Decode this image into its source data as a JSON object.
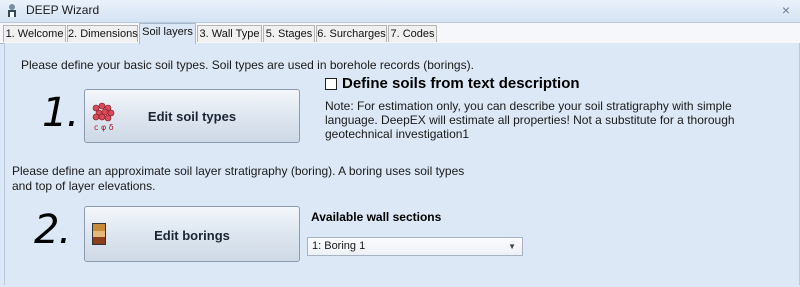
{
  "window": {
    "title": "DEEP Wizard",
    "close_glyph": "×"
  },
  "tabs": [
    {
      "label": "1. Welcome"
    },
    {
      "label": "2. Dimensions"
    },
    {
      "label": "Soil layers",
      "active": true
    },
    {
      "label": "3. Wall Type"
    },
    {
      "label": "5. Stages"
    },
    {
      "label": "6. Surcharges"
    },
    {
      "label": "7. Codes"
    }
  ],
  "soil_section": {
    "intro": "Please define your basic soil types. Soil types are used in borehole records (borings).",
    "step_number": "1.",
    "button_label": "Edit soil types",
    "icon_caption": "c φ δ",
    "icon": "soil-types-icon"
  },
  "text_description": {
    "checkbox_label": "Define soils from text description",
    "checked": false,
    "note_lines": [
      "Note: For estimation only, you can describe your soil stratigraphy with simple",
      "language. DeepEX will estimate all properties! Not a substitute for a thorough",
      "geotechnical investigation1"
    ]
  },
  "boring_section": {
    "intro_lines": [
      "Please define an approximate soil layer stratigraphy (boring). A boring uses soil types",
      "and top of layer elevations."
    ],
    "step_number": "2.",
    "button_label": "Edit borings",
    "icon": "boring-log-icon"
  },
  "wall_sections": {
    "label": "Available wall sections",
    "selected": "1: Boring 1",
    "arrow_glyph": "▼"
  },
  "colors": {
    "panel_bg": "#dce8f5",
    "tab_bg": "#f0f0f0",
    "boring_layers": [
      "#c98a3a",
      "#e8b878",
      "#8a3f1b"
    ]
  }
}
